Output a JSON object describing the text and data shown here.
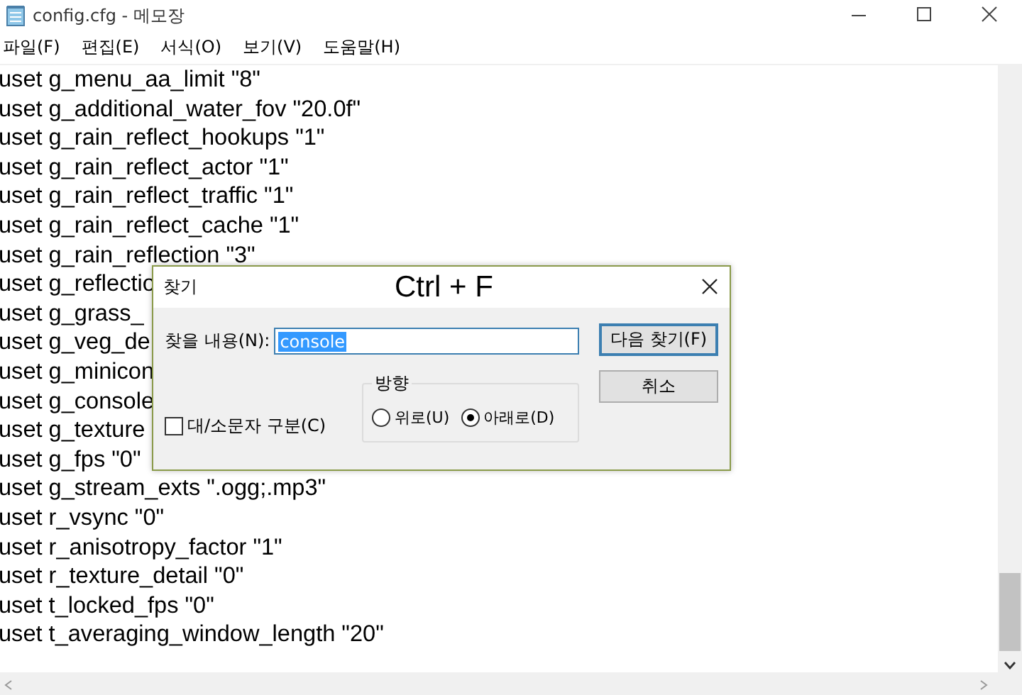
{
  "window": {
    "title": "config.cfg - 메모장"
  },
  "menu": [
    "파일(F)",
    "편집(E)",
    "서식(O)",
    "보기(V)",
    "도움말(H)"
  ],
  "lines": [
    "uset g_menu_aa_limit \"8\"",
    "uset g_additional_water_fov \"20.0f\"",
    "uset g_rain_reflect_hookups \"1\"",
    "uset g_rain_reflect_actor \"1\"",
    "uset g_rain_reflect_traffic \"1\"",
    "uset g_rain_reflect_cache \"1\"",
    "uset g_rain_reflection \"3\"",
    "uset g_reflectio",
    "uset g_grass_",
    "uset g_veg_de",
    "uset g_minicon",
    "uset g_console",
    "uset g_texture",
    "uset g_fps \"0\"",
    "uset g_stream_exts \".ogg;.mp3\"",
    "uset r_vsync \"0\"",
    "uset r_anisotropy_factor \"1\"",
    "uset r_texture_detail \"0\"",
    "uset t_locked_fps \"0\"",
    "uset t_averaging_window_length \"20\""
  ],
  "find_dialog": {
    "title": "찾기",
    "annotation": "Ctrl + F",
    "find_label": "찾을 내용(N):",
    "find_value": "console",
    "value_selected": true,
    "buttons": [
      {
        "label": "다음 찾기(F)",
        "default": true
      },
      {
        "label": "취소",
        "default": false
      }
    ],
    "match_case": {
      "label": "대/소문자 구분(C)",
      "checked": false
    },
    "direction": {
      "label": "방향",
      "options": [
        {
          "label": "위로(U)",
          "selected": false
        },
        {
          "label": "아래로(D)",
          "selected": true
        }
      ]
    }
  }
}
